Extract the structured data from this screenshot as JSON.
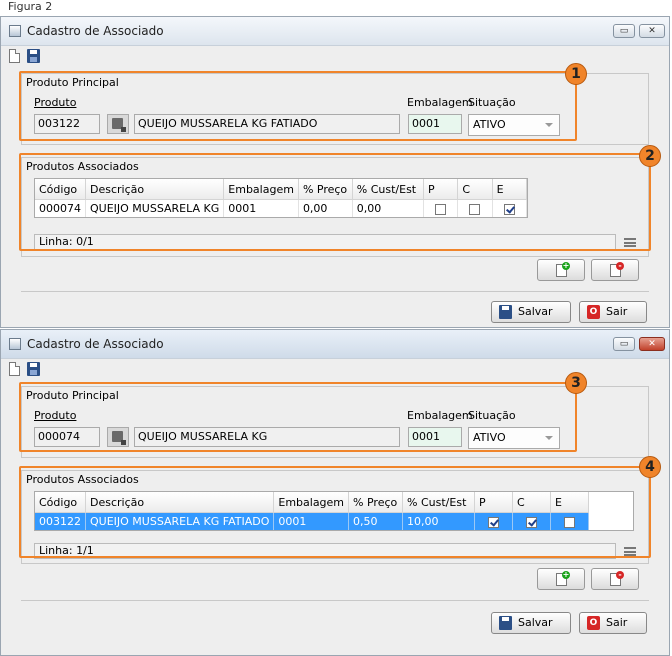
{
  "caption": "Figura 2",
  "windows": [
    {
      "title": "Cadastro de Associado",
      "badges": [
        "1",
        "2"
      ],
      "principal": {
        "group_label": "Produto Principal",
        "produto_label": "Produto",
        "embalagem_label": "Embalagem",
        "situacao_label": "Situação",
        "codigo": "003122",
        "descricao": "QUEIJO MUSSARELA KG FATIADO",
        "embalagem": "0001",
        "situacao": "ATIVO"
      },
      "associados": {
        "group_label": "Produtos Associados",
        "columns": [
          "Código",
          "Descrição",
          "Embalagem",
          "% Preço",
          "% Cust/Est",
          "P",
          "C",
          "E"
        ],
        "rows": [
          {
            "codigo": "000074",
            "descricao": "QUEIJO MUSSARELA KG",
            "embalagem": "0001",
            "preco": "0,00",
            "cust": "0,00",
            "p": false,
            "c": false,
            "e": true
          }
        ],
        "status": "Linha: 0/1"
      },
      "buttons": {
        "save": "Salvar",
        "exit": "Sair"
      }
    },
    {
      "title": "Cadastro de Associado",
      "badges": [
        "3",
        "4"
      ],
      "principal": {
        "group_label": "Produto Principal",
        "produto_label": "Produto",
        "embalagem_label": "Embalagem",
        "situacao_label": "Situação",
        "codigo": "000074",
        "descricao": "QUEIJO MUSSARELA KG",
        "embalagem": "0001",
        "situacao": "ATIVO"
      },
      "associados": {
        "group_label": "Produtos Associados",
        "columns": [
          "Código",
          "Descrição",
          "Embalagem",
          "% Preço",
          "% Cust/Est",
          "P",
          "C",
          "E"
        ],
        "rows": [
          {
            "codigo": "003122",
            "descricao": "QUEIJO MUSSARELA KG FATIADO",
            "embalagem": "0001",
            "preco": "0,50",
            "cust": "10,00",
            "p": true,
            "c": true,
            "e": false
          }
        ],
        "status": "Linha: 1/1"
      },
      "buttons": {
        "save": "Salvar",
        "exit": "Sair"
      }
    }
  ]
}
